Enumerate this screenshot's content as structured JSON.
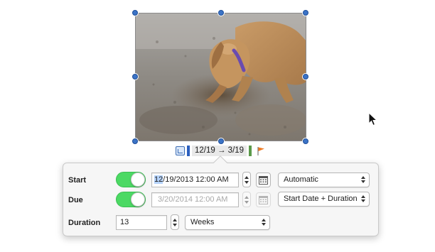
{
  "chip": {
    "date_range": "12/19 → 3/19",
    "icons": [
      "calendar-icon",
      "flag-icon"
    ]
  },
  "popover": {
    "start": {
      "label": "Start",
      "toggle_on": true,
      "value_highlight": "12",
      "value_rest": "/19/2013 12:00 AM",
      "mode": "Automatic"
    },
    "due": {
      "label": "Due",
      "toggle_on": true,
      "value": "3/20/2014 12:00 AM",
      "mode": "Start Date + Duration"
    },
    "duration": {
      "label": "Duration",
      "value": "13",
      "unit": "Weeks"
    }
  },
  "colors": {
    "toggle_on": "#4cd964",
    "handle": "#3b73c6",
    "chip_start": "#2b5fbf",
    "chip_end": "#5b9a4a"
  }
}
